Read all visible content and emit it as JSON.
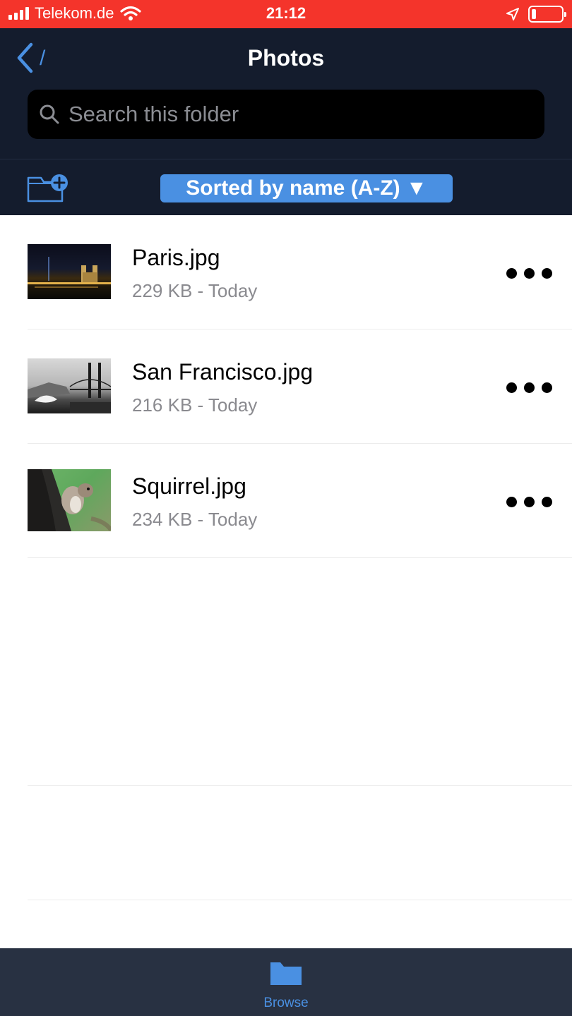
{
  "status_bar": {
    "carrier": "Telekom.de",
    "time": "21:12",
    "battery_level": 0.15
  },
  "nav": {
    "back_path": "/",
    "title": "Photos"
  },
  "search": {
    "placeholder": "Search this folder"
  },
  "toolbar": {
    "sort_label": "Sorted by name (A-Z) ▼"
  },
  "files": [
    {
      "name": "Paris.jpg",
      "meta": "229 KB - Today"
    },
    {
      "name": "San Francisco.jpg",
      "meta": "216 KB - Today"
    },
    {
      "name": "Squirrel.jpg",
      "meta": "234 KB - Today"
    }
  ],
  "tab_bar": {
    "browse_label": "Browse"
  },
  "colors": {
    "status_bar": "#f4342b",
    "nav_background": "#141c2d",
    "accent": "#4a90e2",
    "tab_bar": "#283142"
  }
}
